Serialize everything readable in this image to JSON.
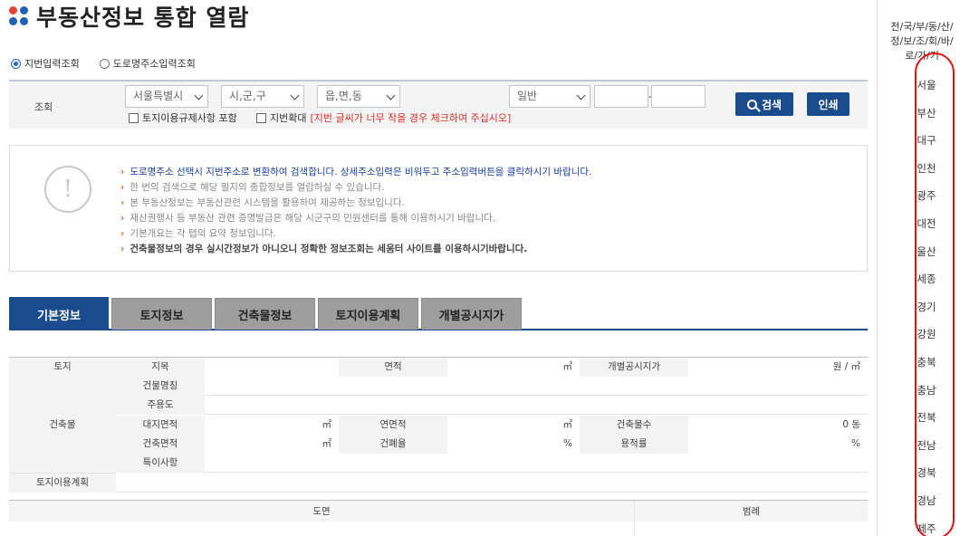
{
  "page": {
    "title": "부동산정보 통합 열람"
  },
  "mode": {
    "options": [
      "지번입력조회",
      "도로명주소입력조회"
    ],
    "selected_index": 0
  },
  "search": {
    "label": "조회",
    "sido": "서울특별시",
    "sigungu": "시,군,구",
    "eupmyeondong": "읍,면,동",
    "type": "일반",
    "dash": "-",
    "check_land_reg": "토지이용규제사항 포함",
    "check_enlarge": "지번확대",
    "check_enlarge_note": "[지번 글씨가 너무 작을 경우 체크하여 주십시오]",
    "search_button": "검색",
    "print_button": "인쇄"
  },
  "notice": {
    "items": [
      "도로명주소 선택시 지번주소로 변환하여 검색합니다. 상세주소입력은 비워두고 주소입력버튼을 클릭하시기 바랍니다.",
      "한 번의 검색으로 해당 필지의 종합정보를 열람하실 수 있습니다.",
      "본 부동산정보는 부동산관련 시스템을 활용하여 제공하는 정보입니다.",
      "재산권행사 등 부동산 관련 증명발급은 해당 시군구의 민원센터를 통해 이용하시기 바랍니다.",
      "기본개요는 각 탭의 요약 정보입니다.",
      "건축물정보의 경우 실시간정보가 아니오니 정확한 정보조회는 세움터 사이트를 이용하시기바랍니다."
    ]
  },
  "tabs": [
    "기본정보",
    "토지정보",
    "건축물정보",
    "토지이용계획",
    "개별공시지가"
  ],
  "info": {
    "land": "토지",
    "jimok": "지목",
    "area": "면적",
    "unit_m2": "㎡",
    "price": "개별공시지가",
    "price_unit": "원 / ㎡",
    "building": "건축물",
    "building_name": "건물명칭",
    "usage": "주용도",
    "site_area": "대지면적",
    "total_floor": "연면적",
    "building_count": "건축물수",
    "building_count_value": "0 동",
    "building_area": "건축면적",
    "coverage": "건폐율",
    "percent": "%",
    "floor_ratio": "용적률",
    "special": "특이사항",
    "land_plan": "토지이용계획"
  },
  "map": {
    "drawing": "도면",
    "legend": "범례"
  },
  "right_panel": {
    "title": "전/국/부/동/산/정/보/조/회/바/로/가/기",
    "cities": [
      "서울",
      "부산",
      "대구",
      "인천",
      "광주",
      "대전",
      "울산",
      "세종",
      "경기",
      "강원",
      "충북",
      "충남",
      "전북",
      "전남",
      "경북",
      "경남",
      "제주"
    ]
  }
}
